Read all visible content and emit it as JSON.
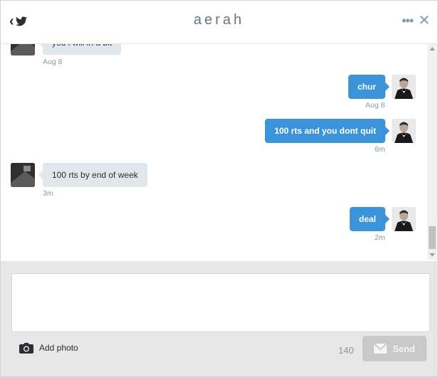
{
  "header": {
    "title": "aerah",
    "back_icon": "chevron-left-icon",
    "brand_icon": "twitter-bird-icon",
    "more_icon": "ellipsis-icon",
    "close_icon": "close-icon",
    "more_text": "•••",
    "close_text": "✕"
  },
  "messages": [
    {
      "side": "in",
      "text": "you i will in a bit",
      "time": "Aug 8"
    },
    {
      "side": "out",
      "text": "chur",
      "time": "Aug 8"
    },
    {
      "side": "out",
      "text": "100 rts and you dont quit",
      "time": "6m"
    },
    {
      "side": "in",
      "text": "100 rts by end of week",
      "time": "3m"
    },
    {
      "side": "out",
      "text": "deal",
      "time": "2m"
    }
  ],
  "composer": {
    "placeholder": "",
    "add_photo_label": "Add photo",
    "camera_icon": "camera-icon",
    "char_count": "140",
    "send_label": "Send",
    "send_icon": "envelope-icon"
  },
  "colors": {
    "sent_bubble": "#3b94d9",
    "received_bubble": "#e1e8ed",
    "send_disabled": "#c9c9c9"
  }
}
